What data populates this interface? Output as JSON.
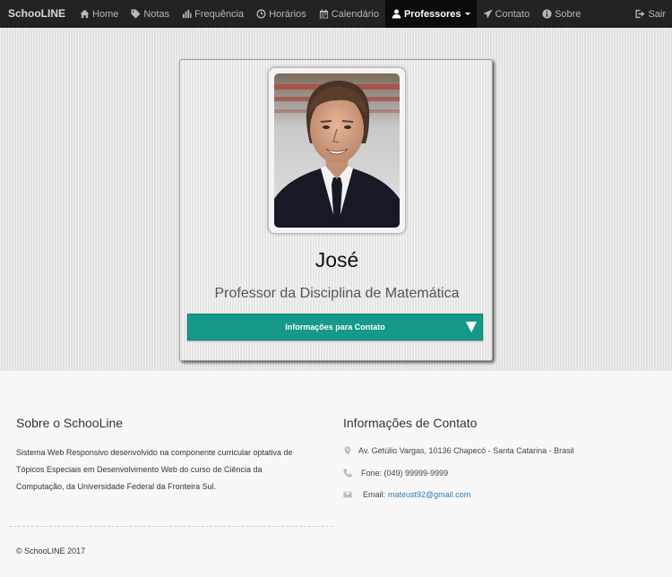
{
  "nav": {
    "brand": "SchooLINE",
    "items": [
      {
        "label": "Home",
        "icon": "home-icon"
      },
      {
        "label": "Notas",
        "icon": "tag-icon"
      },
      {
        "label": "Frequência",
        "icon": "bar-chart-icon"
      },
      {
        "label": "Horários",
        "icon": "clock-icon"
      },
      {
        "label": "Calendário",
        "icon": "calendar-icon"
      },
      {
        "label": "Professores",
        "icon": "user-icon",
        "active": true
      },
      {
        "label": "Contato",
        "icon": "send-icon"
      },
      {
        "label": "Sobre",
        "icon": "info-icon"
      }
    ],
    "logout": {
      "label": "Sair",
      "icon": "logout-icon"
    },
    "active_color": "#0b0b0b",
    "bar_color": "#222222"
  },
  "profile": {
    "name": "José",
    "subtitle": "Professor da Disciplina de Matemática",
    "contact_button": "Informações para Contato",
    "button_color": "#16998a"
  },
  "footer": {
    "about_title": "Sobre o SchooLine",
    "about_text": "Sistema Web Responsivo desenvolvido na componente curricular optativa de Tópicos Especiais em Desenvolvimento Web do curso de Ciência da Computação, da Universidade Federal da Fronteira Sul.",
    "contact_title": "Informações de Contato",
    "address": "Av. Getúlio Vargas, 10136 Chapecó - Santa Catarina - Brasil",
    "phone": "Fone: (049) 99999-9999",
    "email_label": "Email:",
    "email": "mateust92@gmail.com",
    "copyright": "© SchooLINE 2017"
  }
}
